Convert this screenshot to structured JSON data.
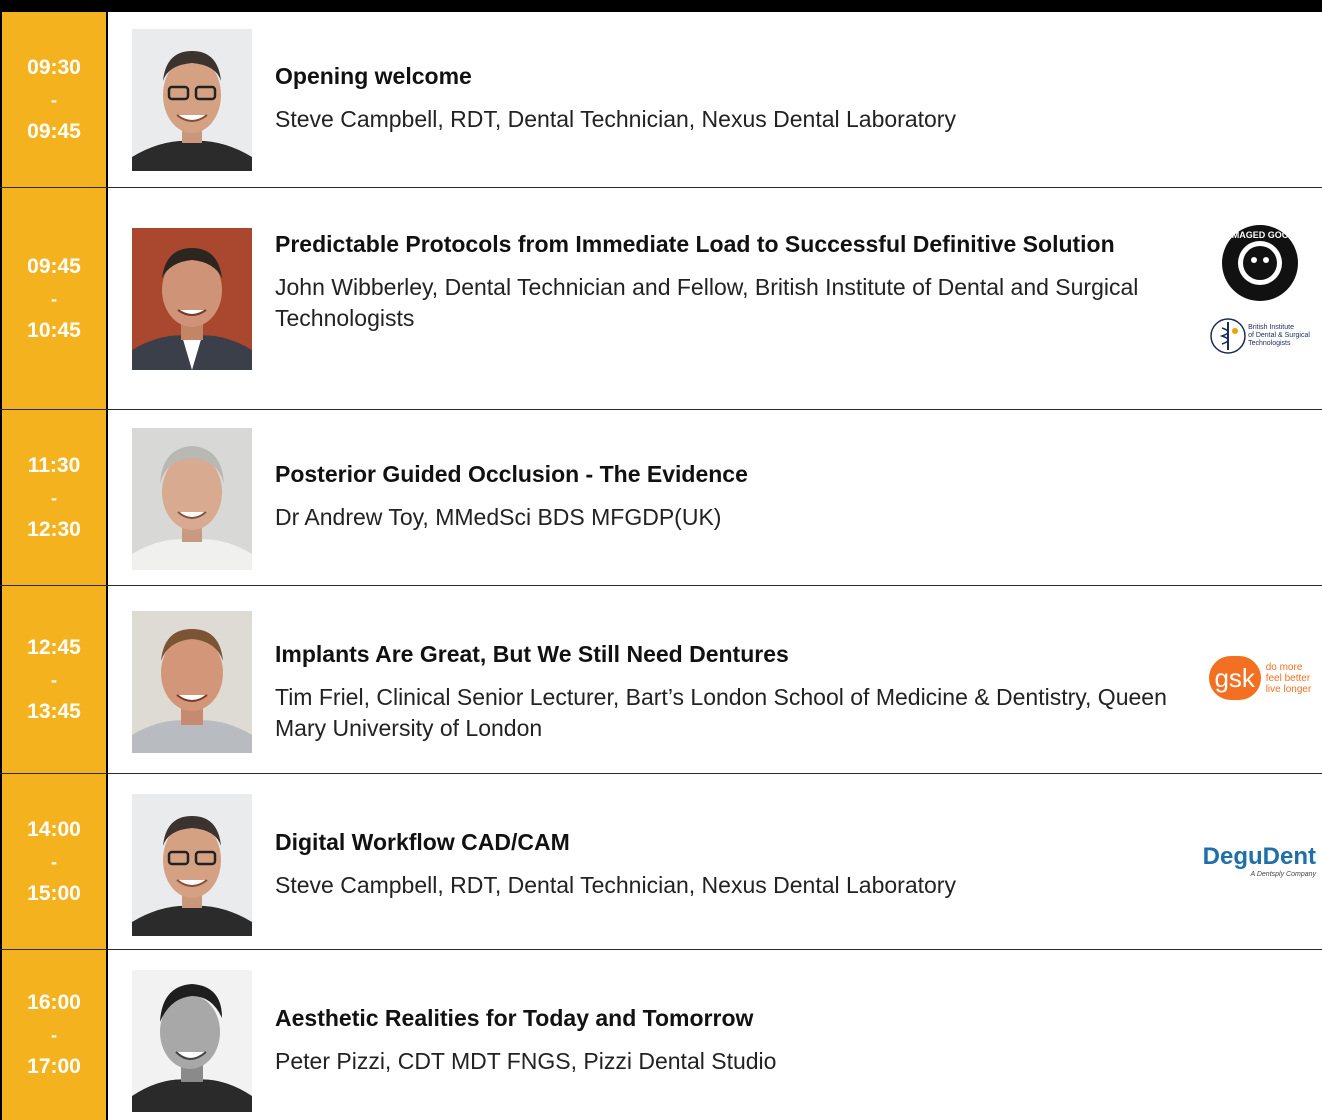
{
  "sessions": [
    {
      "start": "09:30",
      "sep": "-",
      "end": "09:45",
      "title": "Opening welcome",
      "speaker": "Steve Campbell, RDT, Dental Technician, Nexus Dental Laboratory"
    },
    {
      "start": "09:45",
      "sep": "-",
      "end": "10:45",
      "title": "Predictable Protocols from Immediate Load to Successful Definitive Solution",
      "speaker": "John Wibberley, Dental Technician and Fellow, British Institute of Dental and Surgical Technologists",
      "logos": {
        "damaged_goods": "DAMAGED GOODS",
        "bidst_line1": "British Institute",
        "bidst_line2": "of Dental & Surgical",
        "bidst_line3": "Technologists"
      }
    },
    {
      "start": "11:30",
      "sep": "-",
      "end": "12:30",
      "title": "Posterior Guided Occlusion - The Evidence",
      "speaker": "Dr Andrew Toy, MMedSci BDS MFGDP(UK)"
    },
    {
      "start": "12:45",
      "sep": "-",
      "end": "13:45",
      "title": "Implants Are Great, But We Still Need Dentures",
      "speaker": "Tim Friel, Clinical Senior Lecturer, Bart’s London School of Medicine & Dentistry, Queen Mary University of London",
      "logos": {
        "gsk": "gsk",
        "gsk_line1": "do more",
        "gsk_line2": "feel better",
        "gsk_line3": "live longer"
      }
    },
    {
      "start": "14:00",
      "sep": "-",
      "end": "15:00",
      "title": "Digital Workflow CAD/CAM",
      "speaker": "Steve Campbell, RDT, Dental Technician, Nexus Dental Laboratory",
      "logos": {
        "degudent": "DeguDent",
        "degudent_tag": "A Dentsply Company"
      }
    },
    {
      "start": "16:00",
      "sep": "-",
      "end": "17:00",
      "title": "Aesthetic Realities for Today and Tomorrow",
      "speaker": "Peter Pizzi, CDT MDT FNGS, Pizzi Dental Studio"
    }
  ],
  "colors": {
    "time_column": "#f5b21f",
    "gsk_orange": "#f36f21",
    "degudent_blue": "#1f6fa8",
    "bidst_navy": "#1b2a5c"
  }
}
